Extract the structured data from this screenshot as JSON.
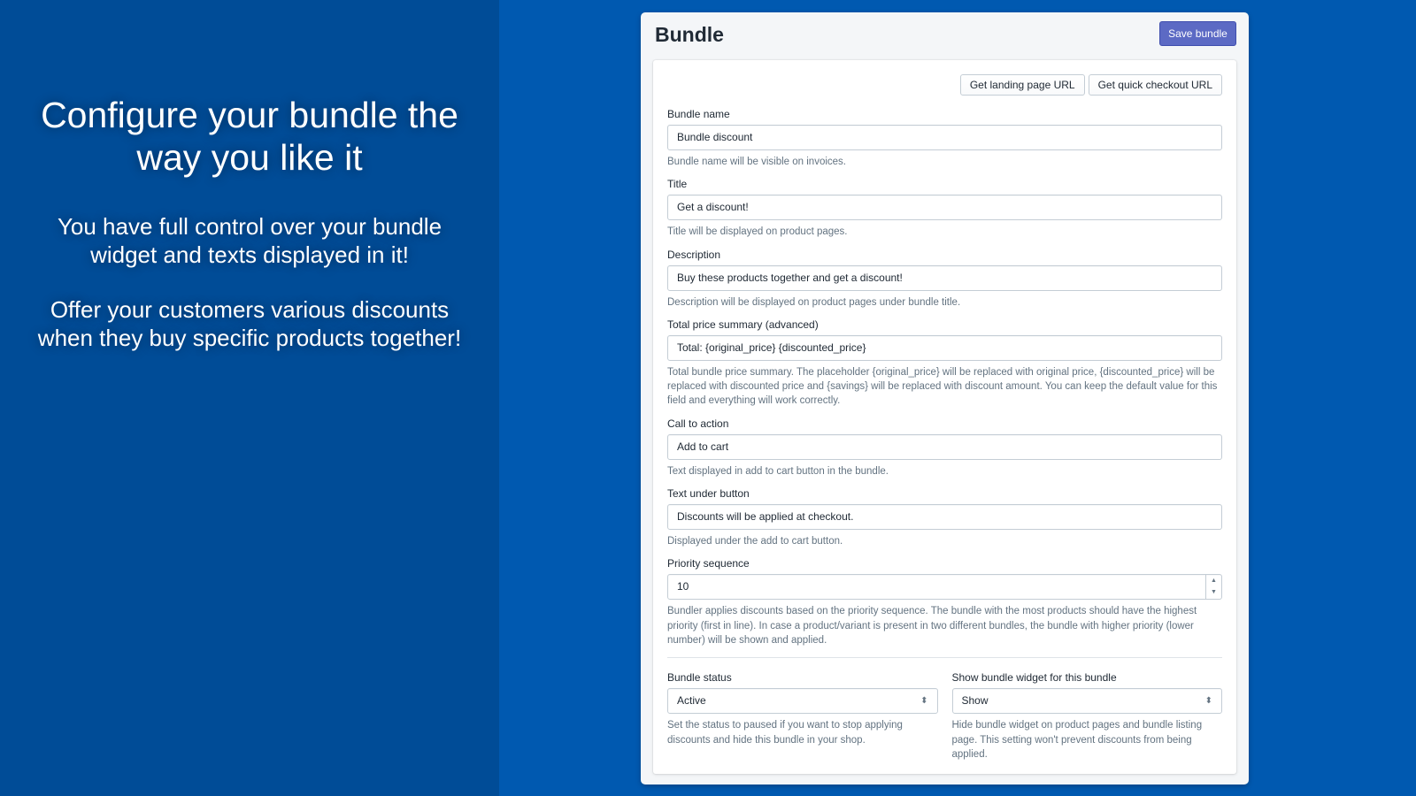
{
  "promo": {
    "headline": "Configure your bundle the way you like it",
    "text1": "You have full control over your bundle widget and texts displayed in it!",
    "text2": "Offer your customers various discounts when they buy specific products together!"
  },
  "header": {
    "title": "Bundle",
    "save_label": "Save bundle"
  },
  "actions": {
    "landing": "Get landing page URL",
    "checkout": "Get quick checkout URL"
  },
  "fields": [
    {
      "label": "Bundle name",
      "value": "Bundle discount",
      "help": "Bundle name will be visible on invoices."
    },
    {
      "label": "Title",
      "value": "Get a discount!",
      "help": "Title will be displayed on product pages."
    },
    {
      "label": "Description",
      "value": "Buy these products together and get a discount!",
      "help": "Description will be displayed on product pages under bundle title."
    },
    {
      "label": "Total price summary (advanced)",
      "value": "Total: {original_price} {discounted_price}",
      "help": "Total bundle price summary. The placeholder {original_price} will be replaced with original price, {discounted_price} will be replaced with discounted price and {savings} will be replaced with discount amount. You can keep the default value for this field and everything will work correctly."
    },
    {
      "label": "Call to action",
      "value": "Add to cart",
      "help": "Text displayed in add to cart button in the bundle."
    },
    {
      "label": "Text under button",
      "value": "Discounts will be applied at checkout.",
      "help": "Displayed under the add to cart button."
    },
    {
      "label": "Priority sequence",
      "value": "10",
      "help": "Bundler applies discounts based on the priority sequence. The bundle with the most products should have the highest priority (first in line). In case a product/variant is present in two different bundles, the bundle with higher priority (lower number) will be shown and applied."
    }
  ],
  "selects": [
    {
      "label": "Bundle status",
      "value": "Active",
      "help": "Set the status to paused if you want to stop applying discounts and hide this bundle in your shop."
    },
    {
      "label": "Show bundle widget for this bundle",
      "value": "Show",
      "help": "Hide bundle widget on product pages and bundle listing page. This setting won't prevent discounts from being applied."
    }
  ],
  "colors": {
    "left_bg": "#004c97",
    "right_bg": "#0059b0",
    "primary": "#5c6ac4"
  }
}
